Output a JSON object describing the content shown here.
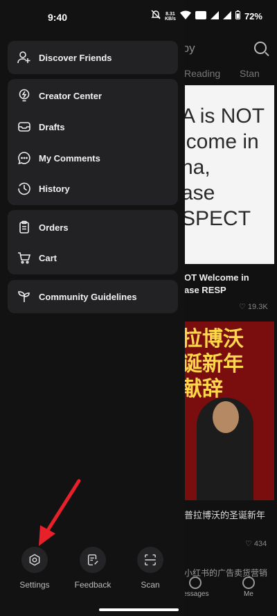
{
  "status_bar": {
    "time": "9:40",
    "net_speed": "8.31",
    "net_unit": "KB/s",
    "battery": "72%"
  },
  "drawer": {
    "groups": [
      {
        "items": [
          {
            "label": "Discover Friends",
            "icon": "add-user-icon"
          }
        ]
      },
      {
        "items": [
          {
            "label": "Creator Center",
            "icon": "lightbulb-icon"
          },
          {
            "label": "Drafts",
            "icon": "inbox-icon"
          },
          {
            "label": "My Comments",
            "icon": "comment-icon"
          },
          {
            "label": "History",
            "icon": "clock-icon"
          }
        ]
      },
      {
        "items": [
          {
            "label": "Orders",
            "icon": "clipboard-icon"
          },
          {
            "label": "Cart",
            "icon": "cart-icon"
          }
        ]
      },
      {
        "items": [
          {
            "label": "Community Guidelines",
            "icon": "sprout-icon"
          }
        ]
      }
    ],
    "bottom": [
      {
        "label": "Settings",
        "icon": "gear-icon"
      },
      {
        "label": "Feedback",
        "icon": "feedback-icon"
      },
      {
        "label": "Scan",
        "icon": "scan-icon"
      }
    ]
  },
  "background_feed": {
    "header_partial": "rby",
    "tabs": [
      "Reading",
      "Stan"
    ],
    "card1": {
      "image_lines": [
        "A is NOT",
        "lcome in",
        "na,",
        "ase",
        "SPECT"
      ],
      "title_lines": [
        "OT Welcome in",
        "ase RESP"
      ],
      "likes": "19.3K"
    },
    "card2": {
      "image_lines": [
        "拉博沃",
        "诞新年",
        "献辞"
      ],
      "title": "普拉博沃的圣诞新年",
      "likes": "434"
    },
    "card3_title": "小红书的广告卖货营销",
    "tab_messages": "lessages",
    "tab_me": "Me"
  },
  "colors": {
    "annotation_arrow": "#e8202a",
    "drawer_bg": "#121212",
    "panel_bg": "#222224"
  }
}
